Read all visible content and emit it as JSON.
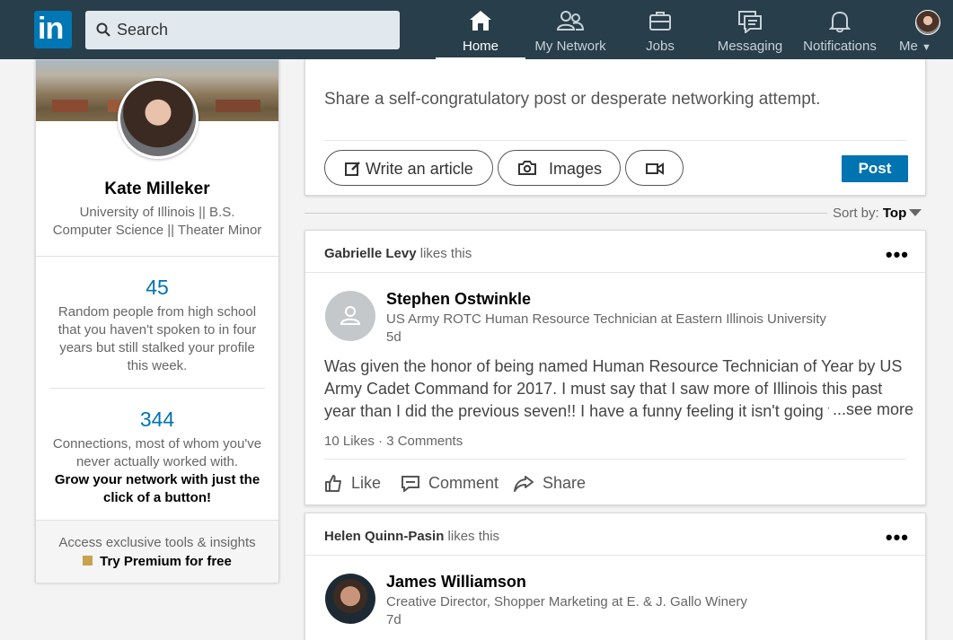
{
  "nav": {
    "search_placeholder": "Search",
    "items": [
      {
        "label": "Home",
        "icon": "home-icon",
        "active": true
      },
      {
        "label": "My Network",
        "icon": "network-icon"
      },
      {
        "label": "Jobs",
        "icon": "briefcase-icon"
      },
      {
        "label": "Messaging",
        "icon": "messaging-icon"
      },
      {
        "label": "Notifications",
        "icon": "bell-icon"
      },
      {
        "label": "Me",
        "icon": "avatar"
      }
    ],
    "colors": {
      "bar": "#283e4a",
      "brand": "#0077b5"
    }
  },
  "profile": {
    "name": "Kate Milleker",
    "headline": "University of Illinois || B.S. Computer Science || Theater Minor",
    "views_count": "45",
    "views_desc": "Random people from high school that you haven't spoken to in four years but still stalked your profile this week.",
    "connections_count": "344",
    "connections_desc": "Connections, most of whom you've never actually worked with.",
    "connections_cta": "Grow your network with just the click of a button!",
    "premium_line": "Access exclusive tools & insights",
    "premium_link": "Try Premium for free"
  },
  "share": {
    "prompt": "Share a self-congratulatory post or desperate networking attempt.",
    "write_article": "Write an article",
    "images": "Images",
    "post": "Post"
  },
  "feed": {
    "sort_label": "Sort by:",
    "sort_value": "Top",
    "posts": [
      {
        "liker": "Gabrielle Levy",
        "liker_suffix": "likes this",
        "author": "Stephen Ostwinkle",
        "title": "US Army ROTC Human Resource Technician at Eastern Illinois University",
        "time": "5d",
        "text": "Was given the honor of being named Human Resource Technician of Year by US Army Cadet Command for 2017. I must say that I saw more of Illinois this past year than I did the previous seven!! I have a funny feeling it isn't going to be",
        "see_more": "...see more",
        "counts": "10 Likes · 3 Comments",
        "like": "Like",
        "comment": "Comment",
        "share": "Share"
      },
      {
        "liker": "Helen Quinn-Pasin",
        "liker_suffix": "likes this",
        "author": "James Williamson",
        "title": "Creative Director, Shopper Marketing at E. & J. Gallo Winery",
        "time": "7d"
      }
    ]
  }
}
